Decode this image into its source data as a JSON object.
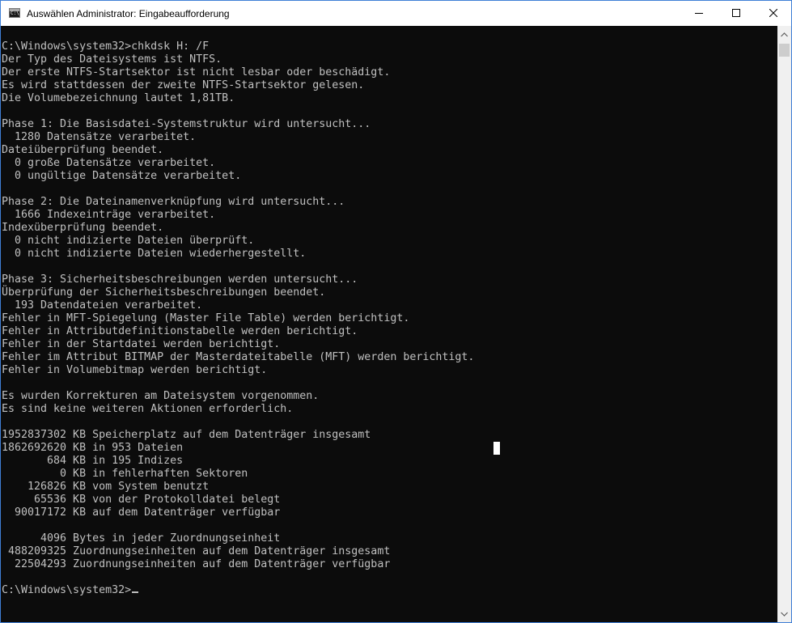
{
  "window": {
    "title": "Auswählen Administrator: Eingabeaufforderung",
    "app_icon": "cmd-icon",
    "app_icon_text": "C:\\",
    "controls": {
      "minimize": "minimize-icon",
      "maximize": "maximize-icon",
      "close": "close-icon"
    }
  },
  "console": {
    "lines": [
      "C:\\Windows\\system32>chkdsk H: /F",
      "Der Typ des Dateisystems ist NTFS.",
      "Der erste NTFS-Startsektor ist nicht lesbar oder beschädigt.",
      "Es wird stattdessen der zweite NTFS-Startsektor gelesen.",
      "Die Volumebezeichnung lautet 1,81TB.",
      "",
      "Phase 1: Die Basisdatei-Systemstruktur wird untersucht...",
      "  1280 Datensätze verarbeitet.",
      "Dateiüberprüfung beendet.",
      "  0 große Datensätze verarbeitet.",
      "  0 ungültige Datensätze verarbeitet.",
      "",
      "Phase 2: Die Dateinamenverknüpfung wird untersucht...",
      "  1666 Indexeinträge verarbeitet.",
      "Indexüberprüfung beendet.",
      "  0 nicht indizierte Dateien überprüft.",
      "  0 nicht indizierte Dateien wiederhergestellt.",
      "",
      "Phase 3: Sicherheitsbeschreibungen werden untersucht...",
      "Überprüfung der Sicherheitsbeschreibungen beendet.",
      "  193 Datendateien verarbeitet.",
      "Fehler in MFT-Spiegelung (Master File Table) werden berichtigt.",
      "Fehler in Attributdefinitionstabelle werden berichtigt.",
      "Fehler in der Startdatei werden berichtigt.",
      "Fehler im Attribut BITMAP der Masterdateitabelle (MFT) werden berichtigt.",
      "Fehler in Volumebitmap werden berichtigt.",
      "",
      "Es wurden Korrekturen am Dateisystem vorgenommen.",
      "Es sind keine weiteren Aktionen erforderlich.",
      "",
      "1952837302 KB Speicherplatz auf dem Datenträger insgesamt",
      "1862692620 KB in 953 Dateien",
      "       684 KB in 195 Indizes",
      "         0 KB in fehlerhaften Sektoren",
      "    126826 KB vom System benutzt",
      "     65536 KB von der Protokolldatei belegt",
      "  90017172 KB auf dem Datenträger verfügbar",
      "",
      "      4096 Bytes in jeder Zuordnungseinheit",
      " 488209325 Zuordnungseinheiten auf dem Datenträger insgesamt",
      "  22504293 Zuordnungseinheiten auf dem Datenträger verfügbar",
      ""
    ],
    "prompt": "C:\\Windows\\system32>"
  },
  "scrollbar": {
    "up": "chevron-up-icon",
    "down": "chevron-down-icon"
  },
  "colors": {
    "console_bg": "#0c0c0c",
    "console_text": "#c0c0c0",
    "titlebar_bg": "#ffffff",
    "window_border": "#3f7fd6"
  }
}
